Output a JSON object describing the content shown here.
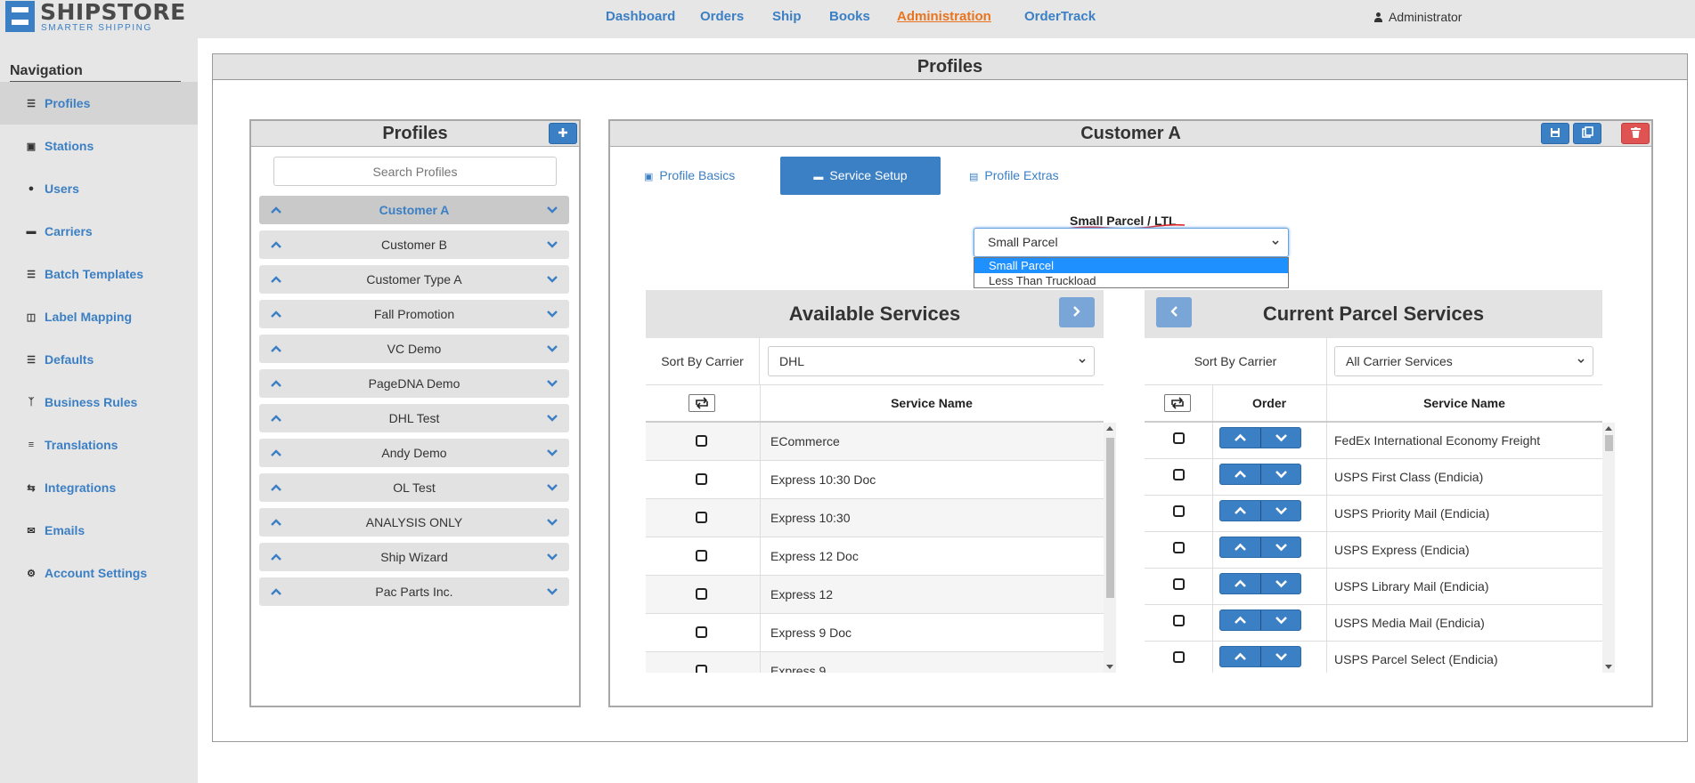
{
  "brand": {
    "name": "SHIPSTORE",
    "tagline": "SMARTER SHIPPING",
    "color": "#3b7fc4"
  },
  "topnav": {
    "items": [
      {
        "label": "Dashboard",
        "active": false
      },
      {
        "label": "Orders",
        "active": false
      },
      {
        "label": "Ship",
        "active": false
      },
      {
        "label": "Books",
        "active": false
      },
      {
        "label": "Administration",
        "active": true
      },
      {
        "label": "OrderTrack",
        "active": false
      }
    ],
    "active_color": "#e8741f",
    "user": "Administrator",
    "user_icon": "user-icon"
  },
  "sidebar": {
    "title": "Navigation",
    "items": [
      {
        "label": "Profiles",
        "icon": "list-icon",
        "active": true
      },
      {
        "label": "Stations",
        "icon": "monitor-icon",
        "active": false
      },
      {
        "label": "Users",
        "icon": "users-icon",
        "active": false
      },
      {
        "label": "Carriers",
        "icon": "truck-icon",
        "active": false
      },
      {
        "label": "Batch Templates",
        "icon": "list-icon",
        "active": false
      },
      {
        "label": "Label Mapping",
        "icon": "map-icon",
        "active": false
      },
      {
        "label": "Defaults",
        "icon": "list-icon",
        "active": false
      },
      {
        "label": "Business Rules",
        "icon": "code-branch-icon",
        "active": false
      },
      {
        "label": "Translations",
        "icon": "translate-icon",
        "active": false
      },
      {
        "label": "Integrations",
        "icon": "exchange-icon",
        "active": false
      },
      {
        "label": "Emails",
        "icon": "envelope-icon",
        "active": false
      },
      {
        "label": "Account Settings",
        "icon": "gear-icon",
        "active": false
      }
    ]
  },
  "page": {
    "title": "Profiles"
  },
  "profiles": {
    "title": "Profiles",
    "add_icon": "plus-icon",
    "search_placeholder": "Search Profiles",
    "items": [
      {
        "label": "Customer A",
        "selected": true
      },
      {
        "label": "Customer B",
        "selected": false
      },
      {
        "label": "Customer Type A",
        "selected": false
      },
      {
        "label": "Fall Promotion",
        "selected": false
      },
      {
        "label": "VC Demo",
        "selected": false
      },
      {
        "label": "PageDNA Demo",
        "selected": false
      },
      {
        "label": "DHL Test",
        "selected": false
      },
      {
        "label": "Andy Demo",
        "selected": false
      },
      {
        "label": "OL Test",
        "selected": false
      },
      {
        "label": "ANALYSIS ONLY",
        "selected": false
      },
      {
        "label": "Ship Wizard",
        "selected": false
      },
      {
        "label": "Pac Parts Inc.",
        "selected": false
      }
    ]
  },
  "detail": {
    "title": "Customer A",
    "actions": [
      {
        "icon": "save-icon"
      },
      {
        "icon": "copy-icon"
      },
      {
        "icon": "trash-icon"
      }
    ],
    "tabs": [
      {
        "label": "Profile Basics",
        "icon": "briefcase-icon",
        "active": false
      },
      {
        "label": "Service Setup",
        "icon": "truck-icon",
        "active": true
      },
      {
        "label": "Profile Extras",
        "icon": "list-icon",
        "active": false
      }
    ],
    "mode_label": "Small Parcel / LTL",
    "mode_value": "Small Parcel",
    "mode_options": [
      {
        "label": "Small Parcel",
        "selected": true
      },
      {
        "label": "Less Than Truckload",
        "selected": false
      }
    ]
  },
  "available": {
    "title": "Available Services",
    "sort_label": "Sort By Carrier",
    "sort_value": "DHL",
    "col_service": "Service Name",
    "rows": [
      {
        "name": "ECommerce"
      },
      {
        "name": "Express 10:30 Doc"
      },
      {
        "name": "Express 10:30"
      },
      {
        "name": "Express 12 Doc"
      },
      {
        "name": "Express 12"
      },
      {
        "name": "Express 9 Doc"
      },
      {
        "name": "Express 9"
      }
    ]
  },
  "current": {
    "title": "Current Parcel Services",
    "sort_label": "Sort By Carrier",
    "sort_value": "All Carrier Services",
    "col_order": "Order",
    "col_service": "Service Name",
    "rows": [
      {
        "name": "FedEx International Economy Freight"
      },
      {
        "name": "USPS First Class (Endicia)"
      },
      {
        "name": "USPS Priority Mail (Endicia)"
      },
      {
        "name": "USPS Express (Endicia)"
      },
      {
        "name": "USPS Library Mail (Endicia)"
      },
      {
        "name": "USPS Media Mail (Endicia)"
      },
      {
        "name": "USPS Parcel Select (Endicia)"
      }
    ]
  }
}
